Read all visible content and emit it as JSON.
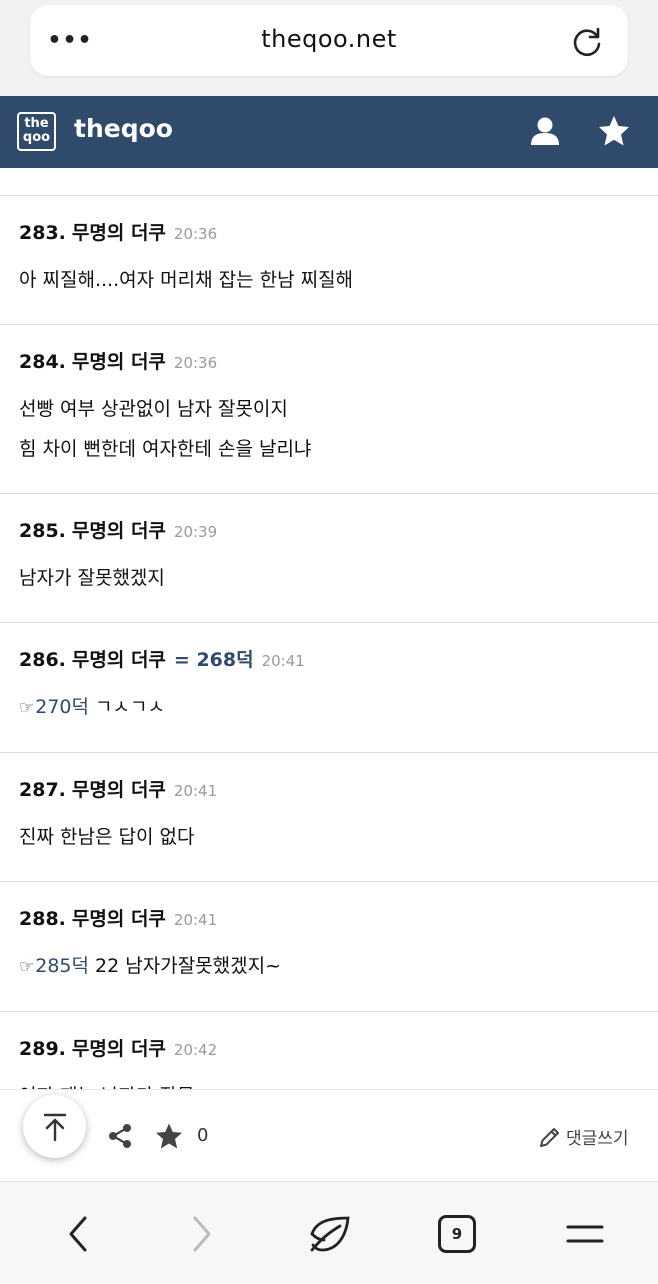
{
  "browser": {
    "menu_label": "•••",
    "url": "theqoo.net",
    "reload_icon": "reload-icon"
  },
  "header": {
    "logo_text": "the qoo",
    "title": "theqoo",
    "user_icon": "user-icon",
    "star_icon": "star-icon",
    "bg_color": "#2f4a6b"
  },
  "comments": [
    {
      "num": "283.",
      "name": "무명의 더쿠",
      "ref_head": "",
      "time": "20:36",
      "lines": [
        {
          "ref": "",
          "text": "아 찌질해....여자 머리채 잡는 한남 찌질해"
        }
      ]
    },
    {
      "num": "284.",
      "name": "무명의 더쿠",
      "ref_head": "",
      "time": "20:36",
      "lines": [
        {
          "ref": "",
          "text": "선빵 여부 상관없이 남자 잘못이지"
        },
        {
          "ref": "",
          "text": "힘 차이 뻔한데 여자한테 손을 날리냐"
        }
      ]
    },
    {
      "num": "285.",
      "name": "무명의 더쿠",
      "ref_head": "",
      "time": "20:39",
      "lines": [
        {
          "ref": "",
          "text": "남자가 잘못했겠지"
        }
      ]
    },
    {
      "num": "286.",
      "name": "무명의 더쿠",
      "ref_head": "= 268덕",
      "time": "20:41",
      "lines": [
        {
          "ref": "270덕",
          "text": "ㄱㅅㄱㅅ"
        }
      ]
    },
    {
      "num": "287.",
      "name": "무명의 더쿠",
      "ref_head": "",
      "time": "20:41",
      "lines": [
        {
          "ref": "",
          "text": "진짜 한남은 답이 없다"
        }
      ]
    },
    {
      "num": "288.",
      "name": "무명의 더쿠",
      "ref_head": "",
      "time": "20:41",
      "lines": [
        {
          "ref": "285덕",
          "text": "22 남자가잘못했겠지~"
        }
      ]
    },
    {
      "num": "289.",
      "name": "무명의 더쿠",
      "ref_head": "",
      "time": "20:42",
      "lines": [
        {
          "ref": "",
          "text": "여자 패는 남자가 잘못"
        }
      ]
    }
  ],
  "action_bar": {
    "scroll_top_icon": "arrow-up-icon",
    "share_icon": "share-icon",
    "favorite_icon": "star-icon",
    "favorite_count": "0",
    "write_label": "댓글쓰기"
  },
  "browser_nav": {
    "back_icon": "chevron-left-icon",
    "forward_icon": "chevron-right-icon",
    "home_icon": "leaf-icon",
    "tab_count": "9",
    "menu_icon": "hamburger-icon"
  }
}
